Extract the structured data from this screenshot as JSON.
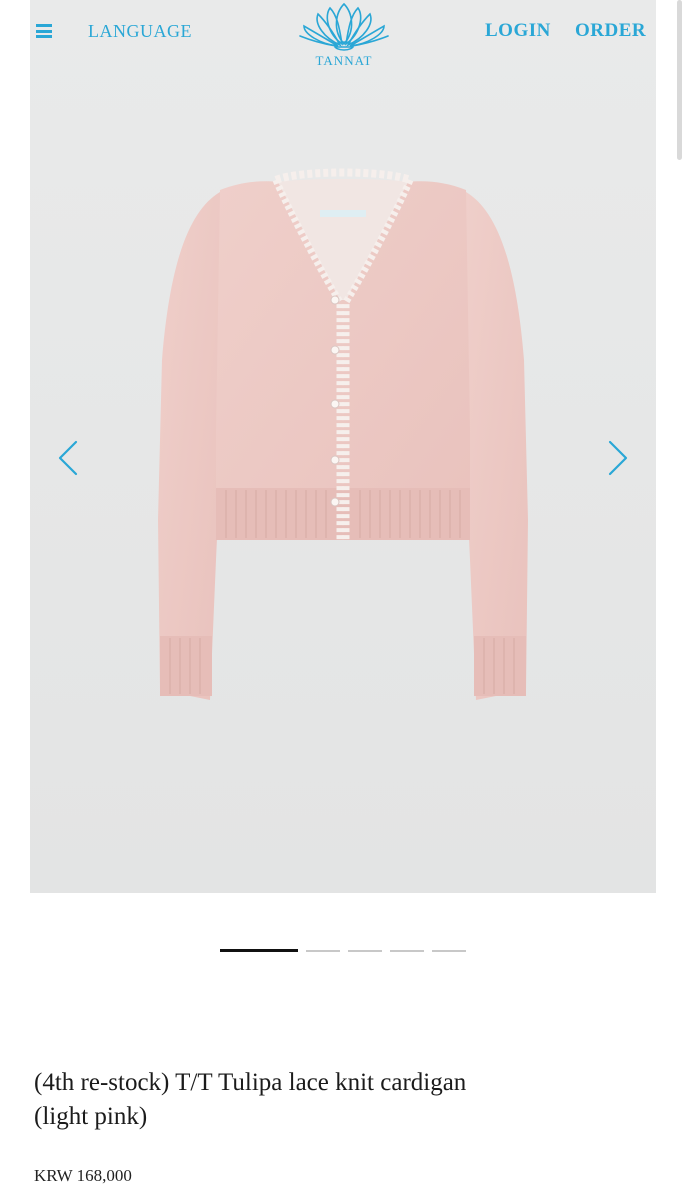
{
  "header": {
    "menu_icon": "hamburger-icon",
    "language_label": "LANGUAGE",
    "brand_name": "TANNAT",
    "login_label": "LOGIN",
    "order_label": "ORDER"
  },
  "gallery": {
    "prev_icon": "chevron-left-icon",
    "next_icon": "chevron-right-icon",
    "image_subject": "light pink lace knit cardigan",
    "slide_count": 5,
    "active_slide": 1
  },
  "product": {
    "title_line1": "(4th re-stock) T/T Tulipa lace knit cardigan",
    "title_line2": "(light pink)",
    "price": "KRW 168,000"
  },
  "colors": {
    "accent": "#2aa7d6",
    "product_pink": "#edc7c2",
    "background_gray": "#e7e8e8"
  }
}
